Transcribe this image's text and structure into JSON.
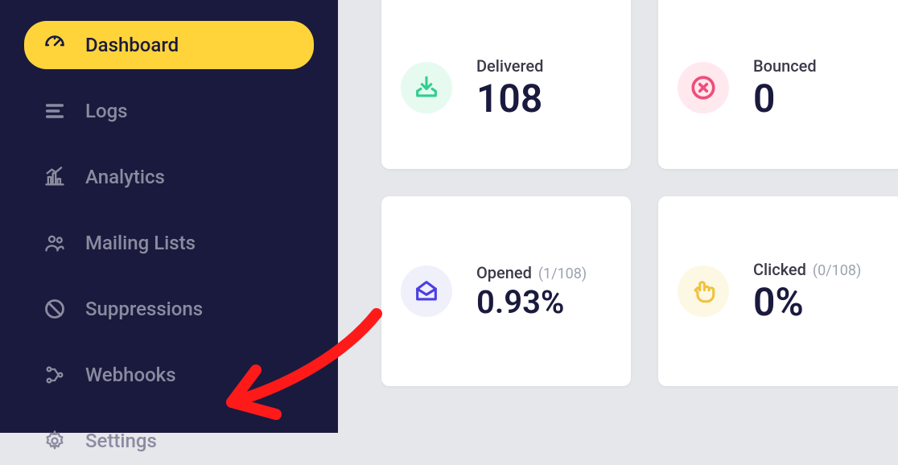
{
  "sidebar": {
    "items": [
      {
        "label": "Dashboard",
        "icon": "gauge-icon",
        "active": true
      },
      {
        "label": "Logs",
        "icon": "lines-icon"
      },
      {
        "label": "Analytics",
        "icon": "chart-icon"
      },
      {
        "label": "Mailing Lists",
        "icon": "users-icon"
      },
      {
        "label": "Suppressions",
        "icon": "no-icon"
      },
      {
        "label": "Webhooks",
        "icon": "nodes-icon"
      },
      {
        "label": "Settings",
        "icon": "gear-icon"
      }
    ]
  },
  "cards": {
    "delivered": {
      "label": "Delivered",
      "value": "108"
    },
    "bounced": {
      "label": "Bounced",
      "value": "0"
    },
    "opened": {
      "label": "Opened",
      "sub": "(1/108)",
      "value": "0.93%"
    },
    "clicked": {
      "label": "Clicked",
      "sub": "(0/108)",
      "value": "0%"
    }
  },
  "colors": {
    "sidebar_bg": "#1a1a3e",
    "active_bg": "#ffd43b",
    "delivered": "#2fcf8e",
    "bounced": "#f04e7a",
    "opened": "#4b3fe3",
    "clicked": "#f0c23d"
  }
}
